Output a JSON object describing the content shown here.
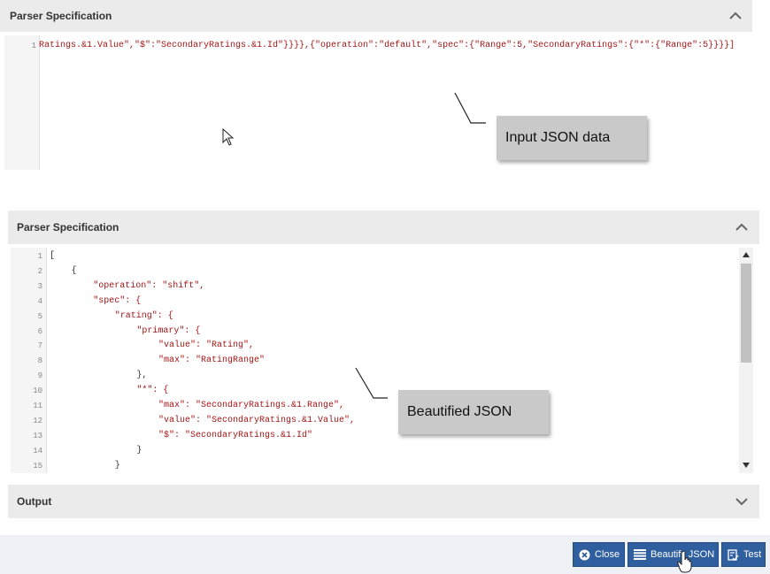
{
  "panel1": {
    "title": "Parser Specification",
    "line_number": "1",
    "code": "Ratings.&1.Value\",\"$\":\"SecondaryRatings.&1.Id\"}}}},{\"operation\":\"default\",\"spec\":{\"Range\":5,\"SecondaryRatings\":{\"*\":{\"Range\":5}}}}]"
  },
  "callout_input": "Input JSON data",
  "panel2": {
    "title": "Parser Specification",
    "lines": [
      {
        "n": "1",
        "indent": 0,
        "text": "["
      },
      {
        "n": "2",
        "indent": 1,
        "text": "{"
      },
      {
        "n": "3",
        "indent": 2,
        "text": "\"operation\": \"shift\","
      },
      {
        "n": "4",
        "indent": 2,
        "text": "\"spec\": {"
      },
      {
        "n": "5",
        "indent": 3,
        "text": "\"rating\": {"
      },
      {
        "n": "6",
        "indent": 4,
        "text": "\"primary\": {"
      },
      {
        "n": "7",
        "indent": 5,
        "text": "\"value\": \"Rating\","
      },
      {
        "n": "8",
        "indent": 5,
        "text": "\"max\": \"RatingRange\""
      },
      {
        "n": "9",
        "indent": 4,
        "text": "},"
      },
      {
        "n": "10",
        "indent": 4,
        "text": "\"*\": {"
      },
      {
        "n": "11",
        "indent": 5,
        "text": "\"max\": \"SecondaryRatings.&1.Range\","
      },
      {
        "n": "12",
        "indent": 5,
        "text": "\"value\": \"SecondaryRatings.&1.Value\","
      },
      {
        "n": "13",
        "indent": 5,
        "text": "\"$\": \"SecondaryRatings.&1.Id\""
      },
      {
        "n": "14",
        "indent": 4,
        "text": "}"
      },
      {
        "n": "15",
        "indent": 3,
        "text": "}"
      }
    ]
  },
  "callout_beautified": "Beautified JSON",
  "output_panel": {
    "title": "Output"
  },
  "buttons": {
    "close": "Close",
    "beautify": "Beautify JSON",
    "test": "Test"
  },
  "colors": {
    "header_bg": "#ebebeb",
    "button_bg": "#2f5f9e",
    "string_color": "#a31515"
  }
}
